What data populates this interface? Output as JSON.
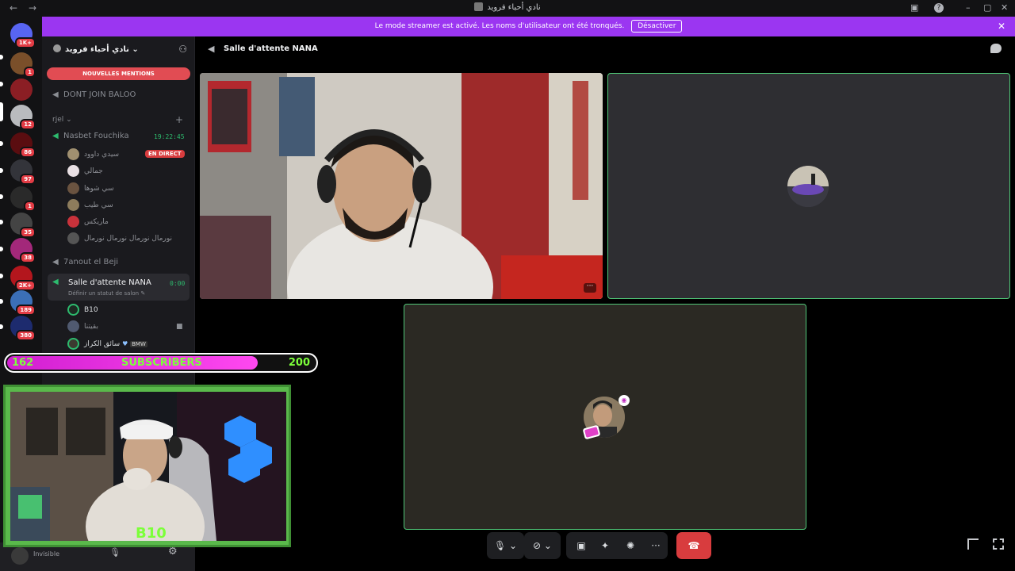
{
  "titlebar": {
    "back_glyph": "←",
    "forward_glyph": "→",
    "title": "نادي أحباء فرويد",
    "inbox_glyph": "▣",
    "help_glyph": "?",
    "min_glyph": "–",
    "max_glyph": "▢",
    "close_glyph": "✕"
  },
  "servers": [
    {
      "name": "discord-home",
      "badge": "1K+",
      "color": "#5865f2"
    },
    {
      "name": "server-1",
      "badge": "1",
      "color": "#7a4f2a"
    },
    {
      "name": "server-2",
      "badge": "",
      "color": "#8b1e24"
    },
    {
      "name": "server-3",
      "badge": "12",
      "color": "#b9bbbe"
    },
    {
      "name": "server-4",
      "badge": "86",
      "color": "#5a0d10"
    },
    {
      "name": "server-5",
      "badge": "97",
      "color": "#33343a"
    },
    {
      "name": "server-6",
      "badge": "1",
      "color": "#2a2a2a"
    },
    {
      "name": "server-7",
      "badge": "35",
      "color": "#444"
    },
    {
      "name": "server-8",
      "badge": "38",
      "color": "#a3287a"
    },
    {
      "name": "server-9",
      "badge": "2K+",
      "color": "#b3161d"
    },
    {
      "name": "server-10",
      "badge": "189",
      "color": "#3b6fb7"
    },
    {
      "name": "server-11",
      "badge": "380",
      "color": "#1d2b6e"
    }
  ],
  "banner": {
    "text": "Le mode streamer est activé. Les noms d'utilisateur ont été tronqués.",
    "button": "Désactiver",
    "close": "✕",
    "color": "#9b36f1"
  },
  "sidebar": {
    "server_name": "نادي أحباء فرويد",
    "mentions": "NOUVELLES MENTIONS",
    "channel_top": "DONT JOIN BALOO",
    "category": "rjel",
    "channel_nasbet": "Nasbet Fouchika",
    "nasbet_timer": "19:22:45",
    "live_badge": "EN DIRECT",
    "nasbet_members": [
      "سيدي داوود",
      "جمالي",
      "سي شوها",
      "سي طيب",
      "ماريكس",
      "نورمال نورمال نورمال نورمال"
    ],
    "channel_7anout": "7anout el Beji",
    "active_channel": "Salle d'attente NANA",
    "active_timer": "0:00",
    "active_status": "Définir un statut de salon",
    "active_members": [
      "B10",
      "بقيتنا",
      "سائق الكراز"
    ],
    "bmw_tag": "BMW",
    "user_status": "Invisible"
  },
  "main": {
    "channel_title": "Salle d'attente NANA",
    "more": "···"
  },
  "controls": {
    "mic": "🎙",
    "cam": "⊘",
    "screen": "▣",
    "activity": "✦",
    "soundboard": "✺",
    "more": "···",
    "hangup": "☎"
  },
  "overlay": {
    "sub_current": "162",
    "sub_label": "SUBSCRIBERS",
    "sub_goal": "200",
    "logo_text": "B10"
  }
}
